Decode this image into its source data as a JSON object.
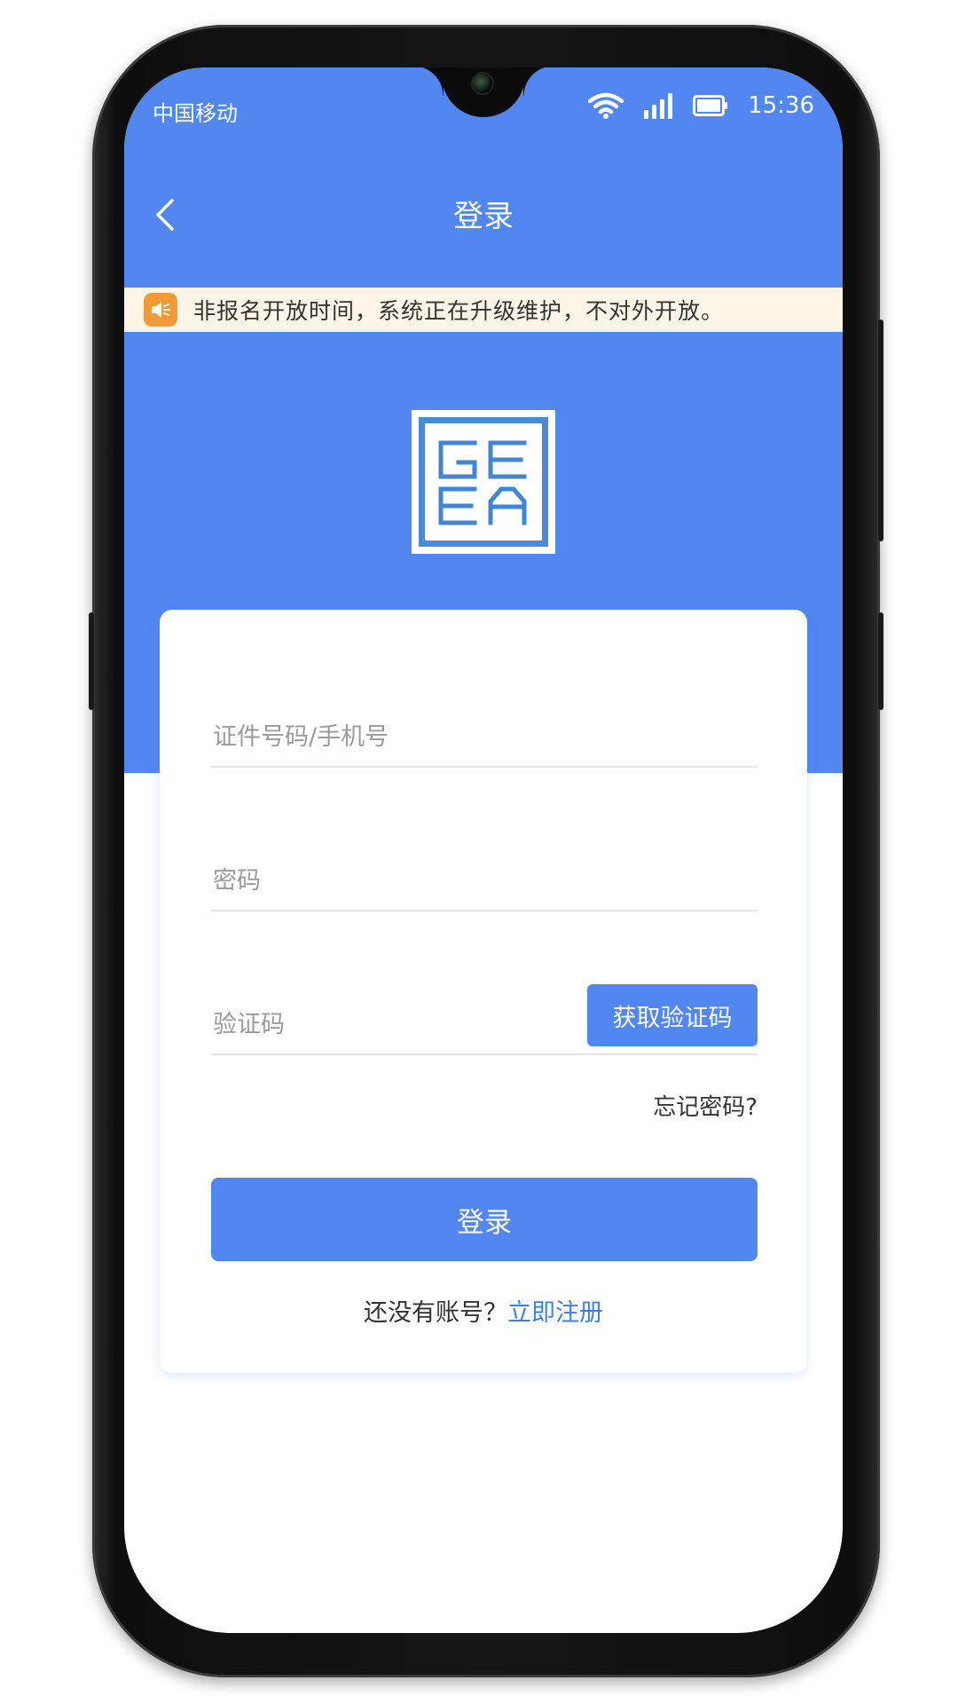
{
  "status_bar": {
    "carrier": "中国移动",
    "time": "15:36"
  },
  "nav": {
    "title": "登录"
  },
  "notice": {
    "text": "非报名开放时间，系统正在升级维护，不对外开放。"
  },
  "form": {
    "id_placeholder": "证件号码/手机号",
    "password_placeholder": "密码",
    "code_placeholder": "验证码",
    "get_code_label": "获取验证码",
    "forgot_label": "忘记密码?",
    "login_label": "登录",
    "no_account_text": "还没有账号？",
    "register_label": "立即注册"
  },
  "colors": {
    "brand_blue": "#5286f1",
    "notice_bg": "#fdf6e8",
    "notice_icon": "#f19a37",
    "link_blue": "#3f7fe0"
  },
  "icons": [
    "back-arrow-icon",
    "wifi-icon",
    "signal-icon",
    "battery-icon",
    "speaker-icon",
    "geea-logo"
  ]
}
